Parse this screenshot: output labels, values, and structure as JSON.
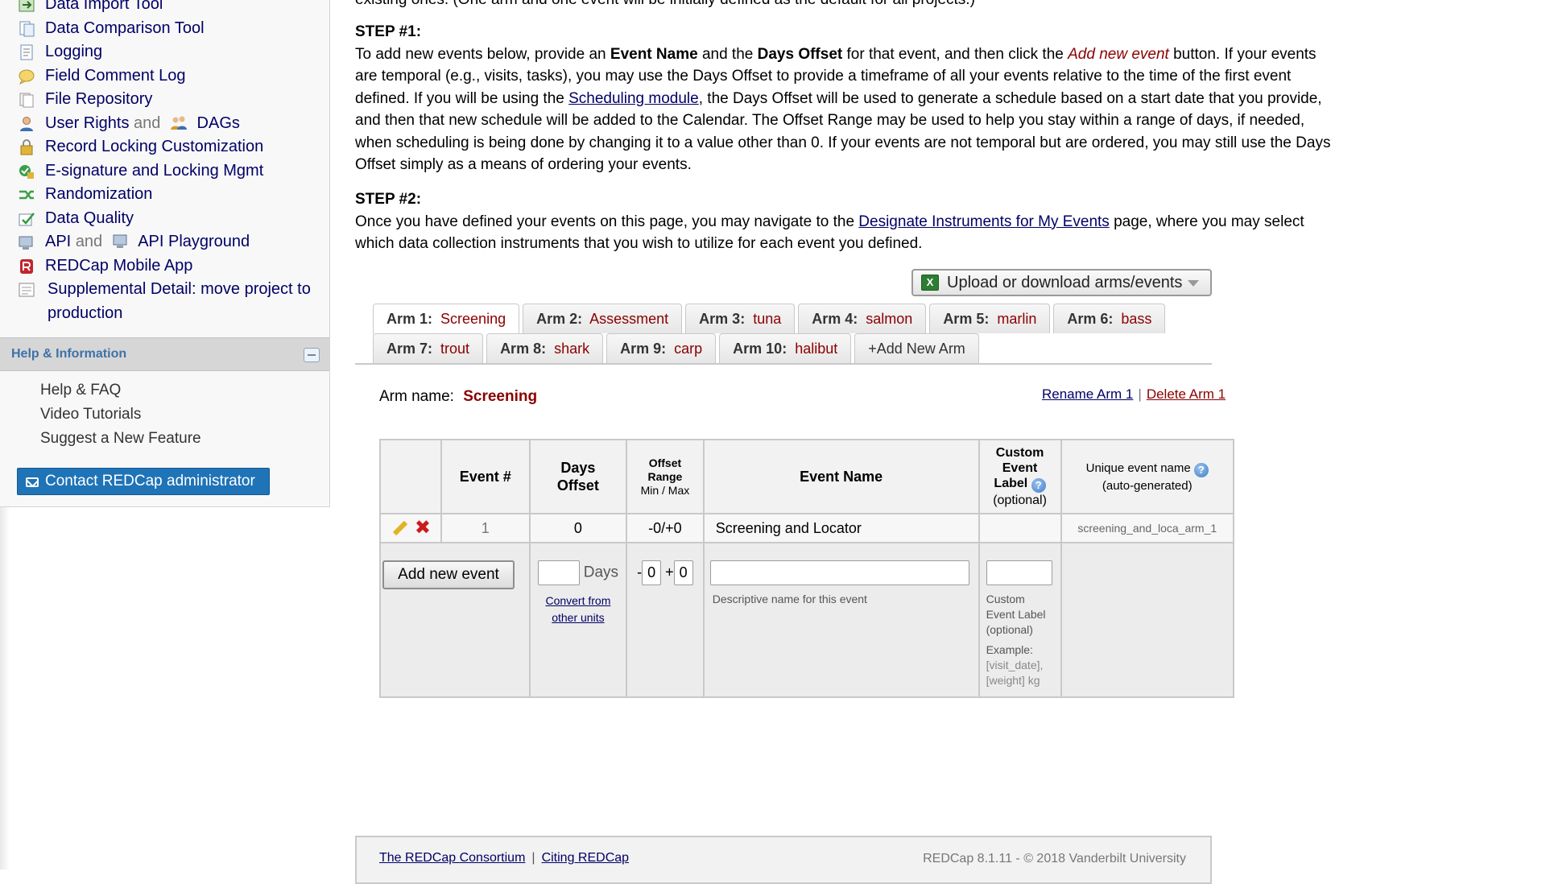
{
  "sidebar": {
    "items": [
      {
        "label": "Data Import Tool",
        "icon": "data-import-icon"
      },
      {
        "label": "Data Comparison Tool",
        "icon": "data-comparison-icon"
      },
      {
        "label": "Logging",
        "icon": "logging-icon"
      },
      {
        "label": "Field Comment Log",
        "icon": "comment-log-icon"
      },
      {
        "label": "File Repository",
        "icon": "file-repository-icon"
      },
      {
        "label": "User Rights",
        "and": "and",
        "label2": "DAGs",
        "icon": "user-icon",
        "icon2": "group-icon"
      },
      {
        "label": "Record Locking Customization",
        "icon": "lock-icon"
      },
      {
        "label": "E-signature and Locking Mgmt",
        "icon": "esignature-icon"
      },
      {
        "label": "Randomization",
        "icon": "randomization-icon"
      },
      {
        "label": "Data Quality",
        "icon": "data-quality-icon"
      },
      {
        "label": "API",
        "and": "and",
        "label2": "API Playground",
        "icon": "api-icon",
        "icon2": "api-playground-icon"
      },
      {
        "label": "REDCap Mobile App",
        "icon": "mobile-app-icon"
      },
      {
        "label": "Supplemental Detail: move project to production",
        "icon": "supplemental-icon"
      }
    ],
    "help": {
      "title": "Help & Information",
      "links": [
        "Help & FAQ",
        "Video Tutorials",
        "Suggest a New Feature"
      ],
      "contact": "Contact REDCap administrator"
    }
  },
  "main": {
    "intro_tail": "existing ones. (One arm and one event will be initially defined as the default for all projects.)",
    "step1": {
      "title": "STEP #1:",
      "t1": "To add new events below, provide an ",
      "b1": "Event Name",
      "t2": " and the ",
      "b2": "Days Offset",
      "t3": " for that event, and then click the ",
      "em": "Add new event",
      "t4": " button. If your events are temporal (e.g., visits, tasks), you may use the Days Offset to provide a timeframe of all your events relative to the time of the first event defined. If you will be using the ",
      "link": "Scheduling module",
      "t5": ", the Days Offset will be used to generate a schedule based on a start date that you provide, and then that new schedule will be added to the Calendar. The Offset Range may be used to help you stay within a range of days, if needed, when scheduling is being done by changing it to a value other than 0. If your events are not temporal but are ordered, you may still use the Days Offset simply as a means of ordering your events."
    },
    "step2": {
      "title": "STEP #2:",
      "t1": "Once you have defined your events on this page, you may navigate to the ",
      "link": "Designate Instruments for My Events",
      "t2": " page, where you may select which data collection instruments that you wish to utilize for each event you defined."
    },
    "upload_button": "Upload or download arms/events",
    "tabs_row1": [
      {
        "k": "Arm 1:",
        "v": "Screening",
        "active": true
      },
      {
        "k": "Arm 2:",
        "v": "Assessment"
      },
      {
        "k": "Arm 3:",
        "v": "tuna"
      },
      {
        "k": "Arm 4:",
        "v": "salmon"
      },
      {
        "k": "Arm 5:",
        "v": "marlin"
      },
      {
        "k": "Arm 6:",
        "v": "bass"
      }
    ],
    "tabs_row2": [
      {
        "k": "Arm 7:",
        "v": "trout"
      },
      {
        "k": "Arm 8:",
        "v": "shark"
      },
      {
        "k": "Arm 9:",
        "v": "carp"
      },
      {
        "k": "Arm 10:",
        "v": "halibut"
      }
    ],
    "add_arm": "+Add New Arm",
    "arm_name_label": "Arm name:",
    "arm_name_value": "Screening",
    "rename_arm": "Rename Arm 1",
    "delete_arm": "Delete Arm 1",
    "table": {
      "headers": {
        "event_num": "Event #",
        "days_offset_1": "Days",
        "days_offset_2": "Offset",
        "offset_range_1": "Offset",
        "offset_range_2": "Range",
        "offset_range_3": "Min / Max",
        "event_name": "Event Name",
        "custom_1": "Custom",
        "custom_2": "Event",
        "custom_3": "Label",
        "custom_4": "(optional)",
        "unique_1": "Unique event name",
        "unique_2": "(auto-generated)"
      },
      "row": {
        "num": "1",
        "days": "0",
        "range": "-0/+0",
        "name": "Screening and Locator",
        "custom": "",
        "unique": "screening_and_loca_arm_1"
      },
      "new_row": {
        "add_button": "Add new event",
        "days_suffix": "Days",
        "convert_link": "Convert from other units",
        "minus": "-",
        "min_val": "0",
        "plus": "+",
        "max_val": "0",
        "name_hint": "Descriptive name for this event",
        "custom_hint": "Custom Event Label (optional)",
        "example_label": "Example:",
        "example_text": "[visit_date], [weight] kg"
      }
    }
  },
  "footer": {
    "consortium": "The REDCap Consortium",
    "citing": "Citing REDCap",
    "separator": "|",
    "version": "REDCap 8.1.11 - © 2018 Vanderbilt University"
  },
  "colors": {
    "link": "#000066",
    "accent_red": "#8b0000",
    "contact_button": "#1f73b7",
    "help_title": "#3e72a8"
  }
}
